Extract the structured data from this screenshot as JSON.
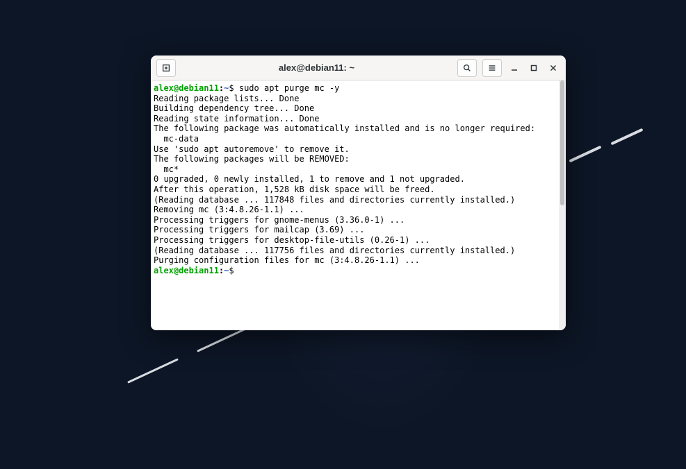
{
  "window": {
    "title": "alex@debian11: ~"
  },
  "prompt": {
    "user_host": "alex@debian11",
    "path": "~",
    "symbol": "$"
  },
  "command1": "sudo apt purge mc -y",
  "output": {
    "line1": "Reading package lists... Done",
    "line2": "Building dependency tree... Done",
    "line3": "Reading state information... Done",
    "line4": "The following package was automatically installed and is no longer required:",
    "line5": "  mc-data",
    "line6": "Use 'sudo apt autoremove' to remove it.",
    "line7": "The following packages will be REMOVED:",
    "line8": "  mc*",
    "line9": "0 upgraded, 0 newly installed, 1 to remove and 1 not upgraded.",
    "line10": "After this operation, 1,528 kB disk space will be freed.",
    "line11": "(Reading database ... 117848 files and directories currently installed.)",
    "line12": "Removing mc (3:4.8.26-1.1) ...",
    "line13": "Processing triggers for gnome-menus (3.36.0-1) ...",
    "line14": "Processing triggers for mailcap (3.69) ...",
    "line15": "Processing triggers for desktop-file-utils (0.26-1) ...",
    "line16": "(Reading database ... 117756 files and directories currently installed.)",
    "line17": "Purging configuration files for mc (3:4.8.26-1.1) ..."
  },
  "command2": ""
}
